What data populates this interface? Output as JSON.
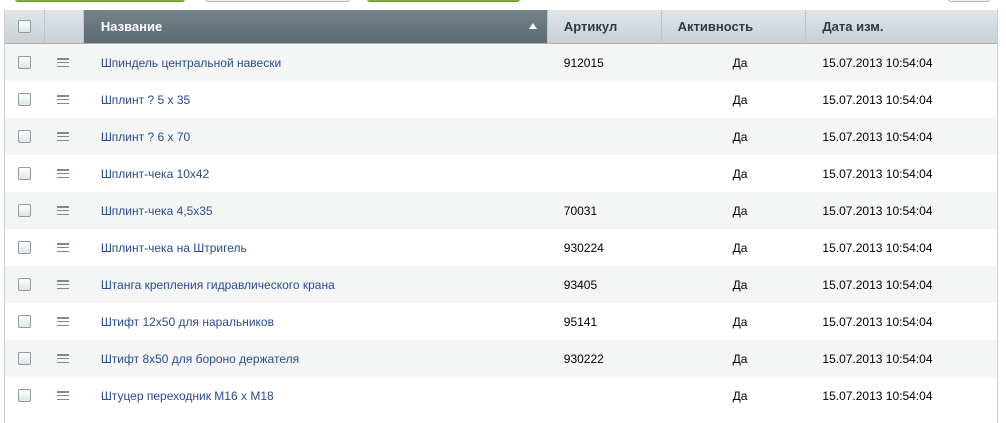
{
  "columns": {
    "name": "Название",
    "article": "Артикул",
    "active": "Активность",
    "date": "Дата изм."
  },
  "rows": [
    {
      "name": "Шпиндель центральной навески",
      "article": "912015",
      "active": "Да",
      "date": "15.07.2013 10:54:04"
    },
    {
      "name": "Шплинт ? 5 х 35",
      "article": "",
      "active": "Да",
      "date": "15.07.2013 10:54:04"
    },
    {
      "name": "Шплинт ? 6 х 70",
      "article": "",
      "active": "Да",
      "date": "15.07.2013 10:54:04"
    },
    {
      "name": "Шплинт-чека 10х42",
      "article": "",
      "active": "Да",
      "date": "15.07.2013 10:54:04"
    },
    {
      "name": "Шплинт-чека 4,5х35",
      "article": "70031",
      "active": "Да",
      "date": "15.07.2013 10:54:04"
    },
    {
      "name": "Шплинт-чека на Штригель",
      "article": "930224",
      "active": "Да",
      "date": "15.07.2013 10:54:04"
    },
    {
      "name": "Штанга крепления гидравлического крана",
      "article": "93405",
      "active": "Да",
      "date": "15.07.2013 10:54:04"
    },
    {
      "name": "Штифт 12х50 для наральников",
      "article": "95141",
      "active": "Да",
      "date": "15.07.2013 10:54:04"
    },
    {
      "name": "Штифт 8х50 для бороно держателя",
      "article": "930222",
      "active": "Да",
      "date": "15.07.2013 10:54:04"
    },
    {
      "name": "Штуцер переходник М16 х М18",
      "article": "",
      "active": "Да",
      "date": "15.07.2013 10:54:04"
    }
  ]
}
